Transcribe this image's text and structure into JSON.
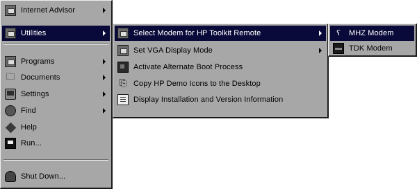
{
  "start_menu": {
    "items": [
      {
        "label": "Internet Advisor",
        "icon": "program-group-icon",
        "submenu": true
      },
      {
        "label": "Utilities",
        "icon": "program-group-icon",
        "submenu": true,
        "selected": true
      },
      {
        "label": "Programs",
        "icon": "programs-icon",
        "submenu": true
      },
      {
        "label": "Documents",
        "icon": "documents-icon",
        "submenu": true
      },
      {
        "label": "Settings",
        "icon": "settings-icon",
        "submenu": true
      },
      {
        "label": "Find",
        "icon": "find-icon",
        "submenu": true
      },
      {
        "label": "Help",
        "icon": "help-icon",
        "submenu": false
      },
      {
        "label": "Run...",
        "icon": "run-icon",
        "submenu": false
      },
      {
        "label": "Shut Down...",
        "icon": "shut-down-icon",
        "submenu": false
      }
    ]
  },
  "utilities_menu": {
    "items": [
      {
        "label": "Select Modem for HP Toolkit Remote",
        "icon": "program-group-icon",
        "submenu": true,
        "selected": true
      },
      {
        "label": "Set VGA Display Mode",
        "icon": "monitor-icon",
        "submenu": true
      },
      {
        "label": "Activate Alternate Boot Process",
        "icon": "boot-icon",
        "submenu": false
      },
      {
        "label": "Copy HP Demo Icons to the Desktop",
        "icon": "copy-icon",
        "submenu": false
      },
      {
        "label": "Display Installation and Version Information",
        "icon": "info-document-icon",
        "submenu": false
      }
    ]
  },
  "modem_menu": {
    "items": [
      {
        "label": "MHZ Modem",
        "icon": "modem-icon",
        "selected": true
      },
      {
        "label": "TDK Modem",
        "icon": "modem-icon",
        "selected": false
      }
    ]
  },
  "colors": {
    "menu_face": "#c8c8c8",
    "highlight": "#0a0a3a",
    "highlight_text": "#ffffff"
  }
}
